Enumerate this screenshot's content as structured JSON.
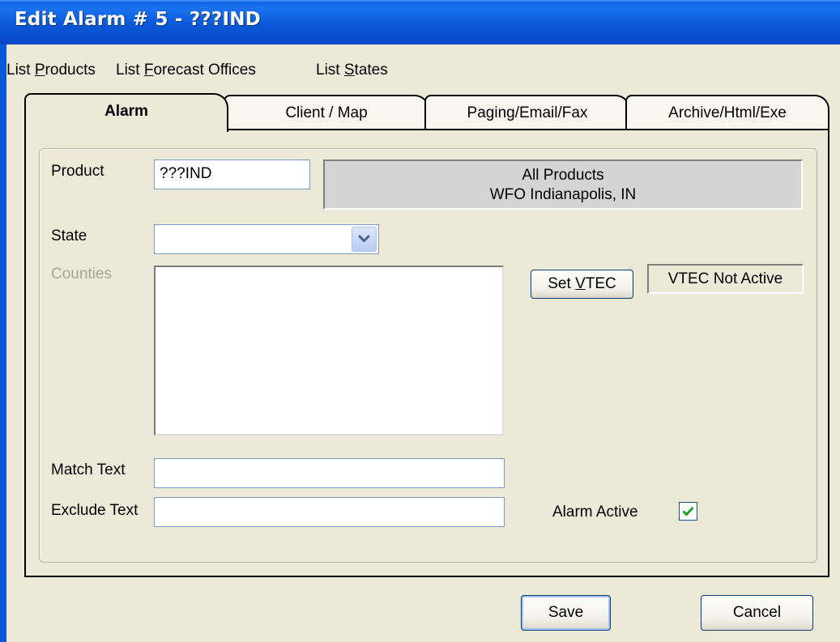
{
  "window": {
    "title": "Edit Alarm # 5 - ???IND"
  },
  "menu": {
    "items": [
      {
        "pre": "List ",
        "mnemonic": "P",
        "post": "roducts"
      },
      {
        "pre": "List ",
        "mnemonic": "F",
        "post": "orecast Offices"
      },
      {
        "pre": "List ",
        "mnemonic": "S",
        "post": "tates"
      }
    ]
  },
  "tabs": [
    {
      "label": "Alarm",
      "active": true
    },
    {
      "label": "Client / Map",
      "active": false
    },
    {
      "label": "Paging/Email/Fax",
      "active": false
    },
    {
      "label": "Archive/Html/Exe",
      "active": false
    }
  ],
  "form": {
    "product_label": "Product",
    "product_value": "???IND",
    "info_line1": "All Products",
    "info_line2": "WFO Indianapolis, IN",
    "state_label": "State",
    "state_value": "",
    "counties_label": "Counties",
    "set_vtec_pre": "Set ",
    "set_vtec_mnemonic": "V",
    "set_vtec_post": "TEC",
    "vtec_status": "VTEC Not Active",
    "match_text_label": "Match Text",
    "match_text_value": "",
    "exclude_text_label": "Exclude Text",
    "exclude_text_value": "",
    "alarm_active_label": "Alarm Active",
    "alarm_active_checked": true
  },
  "buttons": {
    "save": "Save",
    "cancel": "Cancel"
  },
  "colors": {
    "titlebar": "#0a58d8",
    "dialog_bg": "#ece9d8",
    "checkmark": "#21a121"
  }
}
